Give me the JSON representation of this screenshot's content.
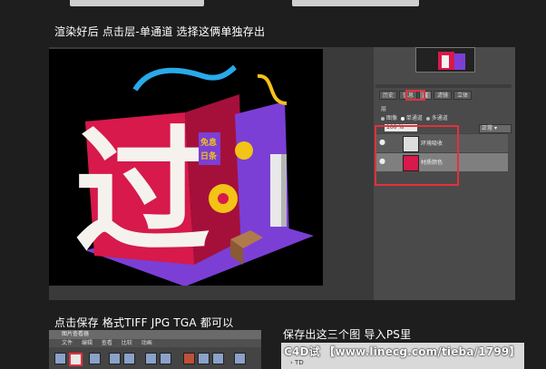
{
  "captions": {
    "step_render": "渲染好后 点击层-单通道 选择这俩单独存出",
    "step_save": "点击保存 格式TIFF JPG TGA 都可以",
    "step_export": "保存出这三个图 导入PS里"
  },
  "render_scene": {
    "big_glyph": "过",
    "sign_top": "免息",
    "sign_bottom": "日条"
  },
  "ps_panel": {
    "tabs": [
      "历史",
      "信息",
      "层",
      "滤镜",
      "立体"
    ],
    "active_tab": "层",
    "section_label": "层",
    "radio_options": [
      "图像",
      "单通道",
      "多通道"
    ],
    "selected_radio": "单通道",
    "opacity_value": "100 %",
    "blend_mode": "正常",
    "layers": [
      {
        "name": "环境吸收",
        "selected": false
      },
      {
        "name": "材质颜色",
        "selected": true
      }
    ]
  },
  "viewer": {
    "title": "图片查看器",
    "menu": [
      "文件",
      "编辑",
      "查看",
      "比较",
      "动画"
    ]
  },
  "file_browser": {
    "folder_label": "TD"
  },
  "watermark": "C4D试   【www.linecg.com/tieba/1799】",
  "colors": {
    "red_highlight": "#e3313c",
    "scene_red": "#d7194b",
    "scene_purple": "#7b3fd6",
    "scene_yellow": "#f3c316",
    "scene_blue": "#2aa9e8"
  }
}
